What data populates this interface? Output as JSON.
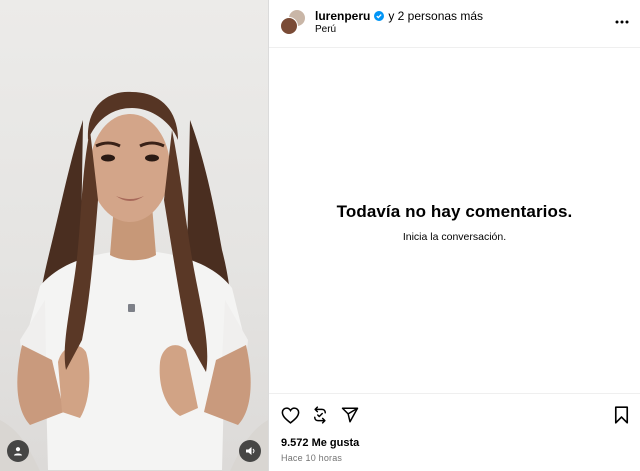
{
  "post": {
    "author": "lurenperu",
    "coauthors_text": "y 2 personas más",
    "location": "Perú"
  },
  "comments": {
    "empty_title": "Todavía no hay comentarios.",
    "empty_subtitle": "Inicia la conversación."
  },
  "footer": {
    "likes": "9.572 Me gusta",
    "timestamp": "Hace 10 horas"
  },
  "icons": {
    "verified": "verified-badge-icon",
    "more": "more-options-icon",
    "like": "heart-icon",
    "repost": "repost-icon",
    "share": "send-icon",
    "save": "bookmark-icon",
    "user_tag": "user-icon",
    "mute": "speaker-icon"
  },
  "colors": {
    "verified": "#0095f6",
    "muted_text": "#737373",
    "divider": "#dbdbdb"
  }
}
